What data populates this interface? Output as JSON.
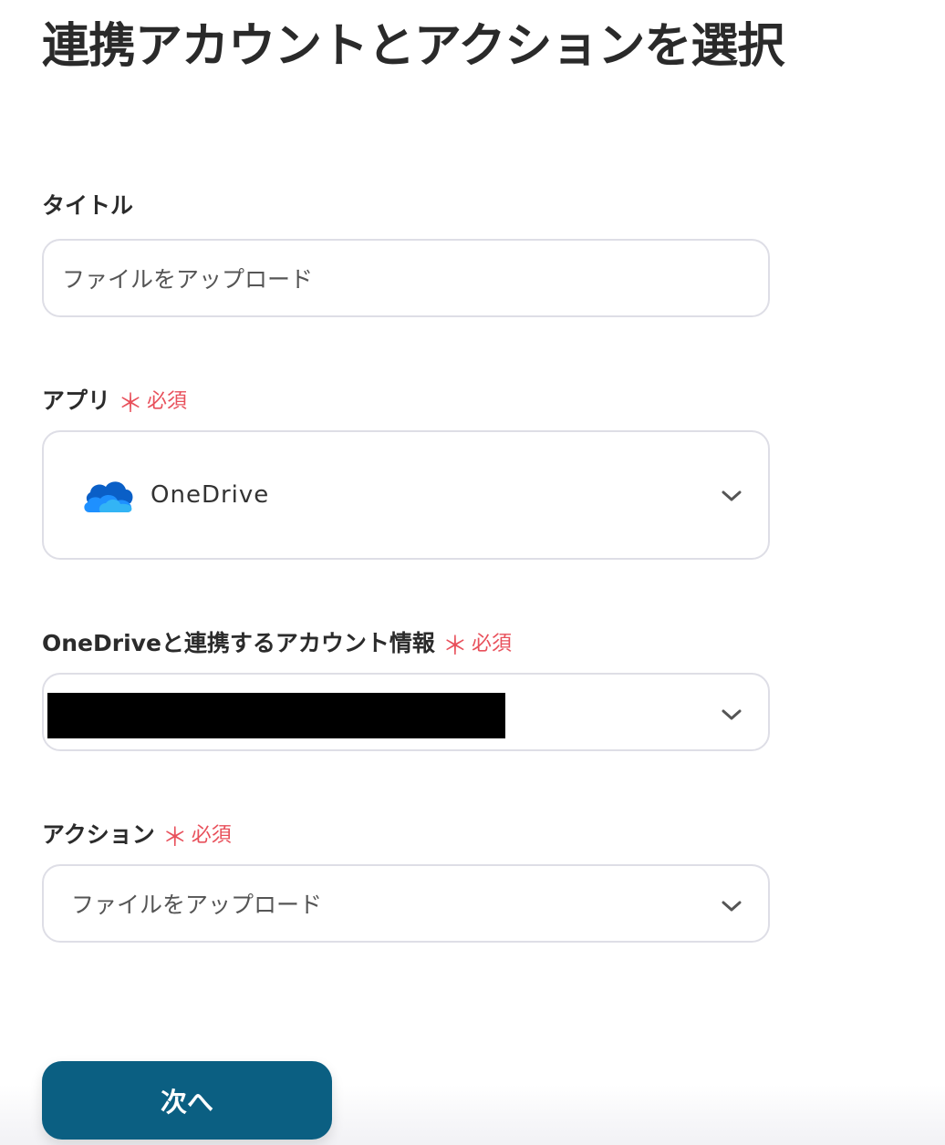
{
  "page": {
    "title": "連携アカウントとアクションを選択"
  },
  "fields": {
    "title": {
      "label": "タイトル",
      "value": "ファイルをアップロード"
    },
    "app": {
      "label": "アプリ",
      "required_mark": "＊",
      "required_text": "必須",
      "value": "OneDrive",
      "icon": "onedrive-cloud-icon"
    },
    "account": {
      "label": "OneDriveと連携するアカウント情報",
      "required_mark": "＊",
      "required_text": "必須",
      "value": ""
    },
    "action": {
      "label": "アクション",
      "required_mark": "＊",
      "required_text": "必須",
      "value": "ファイルをアップロード"
    }
  },
  "buttons": {
    "next_label": "次へ"
  },
  "colors": {
    "primary": "#0b5f82",
    "required": "#e8505b",
    "border": "#dedee6",
    "onedrive_blue": "#0a6ed1"
  }
}
